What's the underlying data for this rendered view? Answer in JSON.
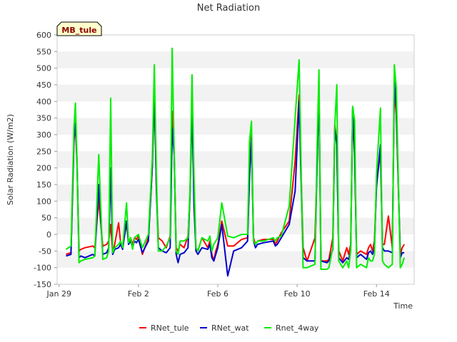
{
  "chart_data": {
    "type": "line",
    "title": "Net Radiation",
    "xlabel": "Time",
    "ylabel": "Solar Radiation (W/m2)",
    "badge": "MB_tule",
    "ylim": [
      -150,
      600
    ],
    "yticks": [
      -150,
      -100,
      -50,
      0,
      50,
      100,
      150,
      200,
      250,
      300,
      350,
      400,
      450,
      500,
      550,
      600
    ],
    "xlim": [
      -0.1,
      17.9
    ],
    "xticks": [
      {
        "value": 0,
        "label": "Jan 29"
      },
      {
        "value": 4,
        "label": "Feb 2"
      },
      {
        "value": 8,
        "label": "Feb 6"
      },
      {
        "value": 12,
        "label": "Feb 10"
      },
      {
        "value": 16,
        "label": "Feb 14"
      }
    ],
    "legend_position": "bottom-center",
    "grid": "horizontal bands",
    "colors": {
      "plot_band": "#f2f2f2",
      "axis": "#cccccc"
    },
    "series": [
      {
        "name": "RNet_tule",
        "color": "#ff0000",
        "x": [
          0.35,
          0.6,
          0.75,
          0.82,
          0.9,
          1.0,
          1.1,
          1.3,
          1.7,
          1.8,
          2.0,
          2.2,
          2.4,
          2.5,
          2.6,
          2.7,
          2.8,
          3.0,
          3.1,
          3.2,
          3.4,
          3.5,
          3.6,
          3.7,
          3.8,
          3.9,
          4.0,
          4.2,
          4.5,
          4.7,
          4.8,
          4.9,
          5.0,
          5.2,
          5.4,
          5.6,
          5.7,
          5.8,
          5.9,
          6.0,
          6.1,
          6.3,
          6.5,
          6.6,
          6.7,
          6.8,
          6.9,
          7.0,
          7.2,
          7.5,
          7.6,
          7.7,
          7.8,
          7.9,
          8.0,
          8.2,
          8.5,
          8.8,
          9.2,
          9.5,
          9.6,
          9.7,
          9.8,
          9.9,
          10.0,
          10.3,
          10.8,
          10.9,
          11.0,
          11.2,
          11.6,
          11.9,
          12.1,
          12.3,
          12.5,
          12.9,
          13.0,
          13.1,
          13.2,
          13.5,
          13.6,
          13.8,
          13.9,
          14.0,
          14.1,
          14.3,
          14.5,
          14.6,
          14.7,
          14.8,
          14.9,
          15.0,
          15.2,
          15.5,
          15.6,
          15.7,
          15.8,
          15.9,
          16.0,
          16.2,
          16.3,
          16.4,
          16.6,
          16.8,
          16.9,
          17.0,
          17.2,
          17.3,
          17.4
        ],
        "y": [
          -60,
          -55,
          280,
          330,
          220,
          -50,
          -45,
          -40,
          -35,
          -40,
          105,
          -35,
          -30,
          -20,
          30,
          -55,
          -30,
          35,
          -25,
          -40,
          35,
          -25,
          -10,
          -30,
          -10,
          -15,
          -5,
          -60,
          -10,
          200,
          430,
          150,
          -10,
          -20,
          -40,
          -5,
          370,
          250,
          -40,
          -50,
          -30,
          -40,
          -5,
          120,
          400,
          150,
          -40,
          -50,
          -10,
          -40,
          -20,
          -60,
          -80,
          -50,
          -30,
          40,
          -35,
          -35,
          -15,
          -10,
          180,
          300,
          -10,
          -30,
          -20,
          -15,
          -15,
          -30,
          -20,
          5,
          40,
          220,
          420,
          -40,
          -80,
          -10,
          200,
          440,
          -80,
          -80,
          -75,
          -10,
          330,
          270,
          -50,
          -80,
          -40,
          -60,
          -30,
          380,
          230,
          -60,
          -50,
          -60,
          -40,
          -30,
          -50,
          -20,
          150,
          250,
          -30,
          -30,
          55,
          -40,
          440,
          360,
          -60,
          -40,
          -30
        ],
        "xi": [
          0.0,
          1.0,
          2.0,
          3.0,
          4.0,
          5.0,
          6.0,
          7.0,
          8.0,
          9.0,
          10.0,
          11.0,
          12.0,
          13.0,
          14.0,
          15.0,
          16.0,
          17.0,
          18.0
        ],
        "note": ""
      },
      {
        "name": "RNet_wat",
        "color": "#0000cc",
        "x": [
          0.35,
          0.6,
          0.75,
          0.82,
          0.9,
          1.0,
          1.1,
          1.3,
          1.7,
          1.8,
          2.0,
          2.2,
          2.4,
          2.5,
          2.6,
          2.7,
          2.8,
          3.0,
          3.1,
          3.2,
          3.4,
          3.5,
          3.6,
          3.7,
          3.8,
          3.9,
          4.0,
          4.2,
          4.5,
          4.7,
          4.8,
          4.9,
          5.0,
          5.2,
          5.4,
          5.6,
          5.7,
          5.8,
          5.9,
          6.0,
          6.1,
          6.3,
          6.5,
          6.6,
          6.7,
          6.8,
          6.9,
          7.0,
          7.2,
          7.5,
          7.6,
          7.7,
          7.8,
          7.9,
          8.0,
          8.2,
          8.5,
          8.8,
          9.2,
          9.5,
          9.6,
          9.7,
          9.8,
          9.9,
          10.0,
          10.3,
          10.8,
          10.9,
          11.0,
          11.2,
          11.6,
          11.9,
          12.1,
          12.3,
          12.5,
          12.9,
          13.0,
          13.1,
          13.2,
          13.5,
          13.6,
          13.8,
          13.9,
          14.0,
          14.1,
          14.3,
          14.5,
          14.6,
          14.7,
          14.8,
          14.9,
          15.0,
          15.2,
          15.5,
          15.6,
          15.7,
          15.8,
          15.9,
          16.0,
          16.2,
          16.3,
          16.4,
          16.6,
          16.8,
          16.9,
          17.0,
          17.2,
          17.3,
          17.4
        ],
        "y": [
          -65,
          -60,
          290,
          335,
          225,
          -70,
          -65,
          -70,
          -60,
          -65,
          150,
          -60,
          -55,
          -40,
          200,
          -60,
          -45,
          -40,
          -30,
          -45,
          40,
          -30,
          -20,
          -40,
          -20,
          -25,
          -15,
          -55,
          -20,
          205,
          440,
          150,
          -40,
          -50,
          -55,
          -40,
          320,
          240,
          -60,
          -85,
          -60,
          -55,
          -40,
          120,
          390,
          85,
          -50,
          -60,
          -40,
          -45,
          -30,
          -70,
          -80,
          -60,
          -40,
          30,
          -125,
          -50,
          -40,
          -20,
          170,
          290,
          -20,
          -40,
          -30,
          -25,
          -20,
          -35,
          -30,
          -10,
          30,
          130,
          400,
          -70,
          -80,
          -80,
          200,
          435,
          -80,
          -85,
          -80,
          -45,
          320,
          270,
          -70,
          -85,
          -70,
          -75,
          -50,
          380,
          240,
          -70,
          -60,
          -75,
          -55,
          -50,
          -60,
          -40,
          140,
          270,
          -40,
          -50,
          -50,
          -55,
          460,
          380,
          -70,
          -55,
          -55
        ],
        "note": ""
      },
      {
        "name": "Rnet_4way",
        "color": "#00ee00",
        "x": [
          0.35,
          0.6,
          0.75,
          0.82,
          0.9,
          1.0,
          1.1,
          1.3,
          1.7,
          1.8,
          2.0,
          2.2,
          2.4,
          2.5,
          2.6,
          2.7,
          2.8,
          3.0,
          3.1,
          3.2,
          3.4,
          3.5,
          3.6,
          3.7,
          3.8,
          3.9,
          4.0,
          4.2,
          4.5,
          4.7,
          4.8,
          4.9,
          5.0,
          5.2,
          5.4,
          5.6,
          5.7,
          5.8,
          5.9,
          6.0,
          6.1,
          6.3,
          6.5,
          6.6,
          6.7,
          6.8,
          6.9,
          7.0,
          7.2,
          7.5,
          7.6,
          7.7,
          7.8,
          7.9,
          8.0,
          8.2,
          8.5,
          8.8,
          9.2,
          9.5,
          9.6,
          9.7,
          9.8,
          9.9,
          10.0,
          10.3,
          10.8,
          10.9,
          11.0,
          11.2,
          11.6,
          11.9,
          12.1,
          12.3,
          12.5,
          12.9,
          13.0,
          13.1,
          13.2,
          13.5,
          13.6,
          13.8,
          13.9,
          14.0,
          14.1,
          14.3,
          14.5,
          14.6,
          14.7,
          14.8,
          14.9,
          15.0,
          15.2,
          15.5,
          15.6,
          15.7,
          15.8,
          15.9,
          16.0,
          16.2,
          16.3,
          16.4,
          16.6,
          16.8,
          16.9,
          17.0,
          17.2,
          17.3,
          17.4
        ],
        "y": [
          -45,
          -35,
          320,
          395,
          230,
          -85,
          -80,
          -75,
          -70,
          -65,
          240,
          -75,
          -70,
          -50,
          410,
          -55,
          -40,
          -30,
          -20,
          -40,
          95,
          -25,
          -10,
          -45,
          -10,
          -5,
          0,
          -40,
          0,
          230,
          510,
          200,
          -50,
          -50,
          -35,
          -10,
          560,
          250,
          -50,
          -60,
          -20,
          -20,
          -10,
          130,
          480,
          175,
          -40,
          -50,
          -10,
          -20,
          -5,
          -50,
          -30,
          -20,
          -10,
          95,
          -5,
          -10,
          0,
          0,
          280,
          340,
          -20,
          -30,
          -20,
          -20,
          -10,
          -20,
          -10,
          -5,
          85,
          350,
          525,
          -100,
          -100,
          -90,
          250,
          495,
          -105,
          -105,
          -100,
          -40,
          330,
          450,
          -80,
          -100,
          -80,
          -100,
          -50,
          385,
          340,
          -100,
          -90,
          -100,
          -70,
          -80,
          -80,
          -60,
          180,
          380,
          -80,
          -90,
          -100,
          -90,
          510,
          440,
          -100,
          -90,
          -70
        ],
        "note": ""
      }
    ]
  }
}
